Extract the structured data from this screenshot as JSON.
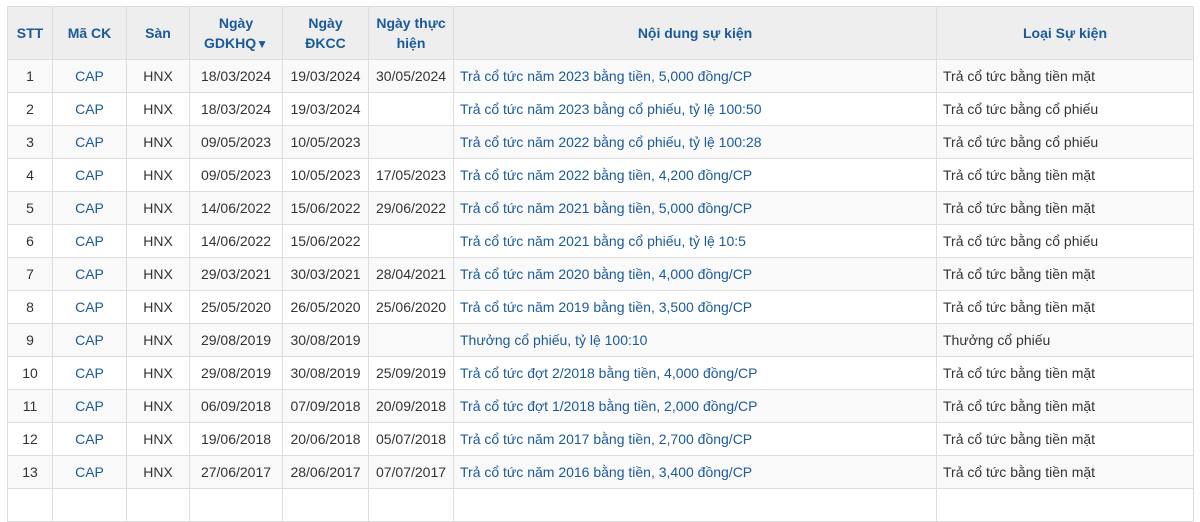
{
  "table": {
    "headers": {
      "stt": "STT",
      "ma_ck": "Mã CK",
      "san": "Sàn",
      "ngay_gdkhq_line1": "Ngày",
      "ngay_gdkhq_line2": "GDKHQ",
      "sort_indicator": "▼",
      "ngay_dkcc_line1": "Ngày",
      "ngay_dkcc_line2": "ĐKCC",
      "ngay_thuc_hien_line1": "Ngày thực",
      "ngay_thuc_hien_line2": "hiện",
      "noi_dung": "Nội dung sự kiện",
      "loai_su_kien": "Loại Sự kiện"
    },
    "rows": [
      {
        "stt": "1",
        "ma_ck": "CAP",
        "san": "HNX",
        "gdkhq": "18/03/2024",
        "dkcc": "19/03/2024",
        "thuc_hien": "30/05/2024",
        "noi_dung": "Trả cổ tức năm 2023 bằng tiền, 5,000 đồng/CP",
        "loai": "Trả cổ tức bằng tiền mặt"
      },
      {
        "stt": "2",
        "ma_ck": "CAP",
        "san": "HNX",
        "gdkhq": "18/03/2024",
        "dkcc": "19/03/2024",
        "thuc_hien": "",
        "noi_dung": "Trả cổ tức năm 2023 bằng cổ phiếu, tỷ lệ 100:50",
        "loai": "Trả cổ tức bằng cổ phiếu"
      },
      {
        "stt": "3",
        "ma_ck": "CAP",
        "san": "HNX",
        "gdkhq": "09/05/2023",
        "dkcc": "10/05/2023",
        "thuc_hien": "",
        "noi_dung": "Trả cổ tức năm 2022 bằng cổ phiếu, tỷ lệ 100:28",
        "loai": "Trả cổ tức bằng cổ phiếu"
      },
      {
        "stt": "4",
        "ma_ck": "CAP",
        "san": "HNX",
        "gdkhq": "09/05/2023",
        "dkcc": "10/05/2023",
        "thuc_hien": "17/05/2023",
        "noi_dung": "Trả cổ tức năm 2022 bằng tiền, 4,200 đồng/CP",
        "loai": "Trả cổ tức bằng tiền mặt"
      },
      {
        "stt": "5",
        "ma_ck": "CAP",
        "san": "HNX",
        "gdkhq": "14/06/2022",
        "dkcc": "15/06/2022",
        "thuc_hien": "29/06/2022",
        "noi_dung": "Trả cổ tức năm 2021 bằng tiền, 5,000 đồng/CP",
        "loai": "Trả cổ tức bằng tiền mặt"
      },
      {
        "stt": "6",
        "ma_ck": "CAP",
        "san": "HNX",
        "gdkhq": "14/06/2022",
        "dkcc": "15/06/2022",
        "thuc_hien": "",
        "noi_dung": "Trả cổ tức năm 2021 bằng cổ phiếu, tỷ lệ 10:5",
        "loai": "Trả cổ tức bằng cổ phiếu"
      },
      {
        "stt": "7",
        "ma_ck": "CAP",
        "san": "HNX",
        "gdkhq": "29/03/2021",
        "dkcc": "30/03/2021",
        "thuc_hien": "28/04/2021",
        "noi_dung": "Trả cổ tức năm 2020 bằng tiền, 4,000 đồng/CP",
        "loai": "Trả cổ tức bằng tiền mặt"
      },
      {
        "stt": "8",
        "ma_ck": "CAP",
        "san": "HNX",
        "gdkhq": "25/05/2020",
        "dkcc": "26/05/2020",
        "thuc_hien": "25/06/2020",
        "noi_dung": "Trả cổ tức năm 2019 bằng tiền, 3,500 đồng/CP",
        "loai": "Trả cổ tức bằng tiền mặt"
      },
      {
        "stt": "9",
        "ma_ck": "CAP",
        "san": "HNX",
        "gdkhq": "29/08/2019",
        "dkcc": "30/08/2019",
        "thuc_hien": "",
        "noi_dung": "Thưởng cổ phiếu, tỷ lệ 100:10",
        "loai": "Thưởng cổ phiếu"
      },
      {
        "stt": "10",
        "ma_ck": "CAP",
        "san": "HNX",
        "gdkhq": "29/08/2019",
        "dkcc": "30/08/2019",
        "thuc_hien": "25/09/2019",
        "noi_dung": "Trả cổ tức đợt 2/2018 bằng tiền, 4,000 đồng/CP",
        "loai": "Trả cổ tức bằng tiền mặt"
      },
      {
        "stt": "11",
        "ma_ck": "CAP",
        "san": "HNX",
        "gdkhq": "06/09/2018",
        "dkcc": "07/09/2018",
        "thuc_hien": "20/09/2018",
        "noi_dung": "Trả cổ tức đợt 1/2018 bằng tiền, 2,000 đồng/CP",
        "loai": "Trả cổ tức bằng tiền mặt"
      },
      {
        "stt": "12",
        "ma_ck": "CAP",
        "san": "HNX",
        "gdkhq": "19/06/2018",
        "dkcc": "20/06/2018",
        "thuc_hien": "05/07/2018",
        "noi_dung": "Trả cổ tức năm 2017 bằng tiền, 2,700 đồng/CP",
        "loai": "Trả cổ tức bằng tiền mặt"
      },
      {
        "stt": "13",
        "ma_ck": "CAP",
        "san": "HNX",
        "gdkhq": "27/06/2017",
        "dkcc": "28/06/2017",
        "thuc_hien": "07/07/2017",
        "noi_dung": "Trả cổ tức năm 2016 bằng tiền, 3,400 đồng/CP",
        "loai": "Trả cổ tức bằng tiền mặt"
      },
      {
        "stt": "",
        "ma_ck": "",
        "san": "",
        "gdkhq": "",
        "dkcc": "",
        "thuc_hien": "",
        "noi_dung": "",
        "loai": ""
      }
    ]
  },
  "colors": {
    "header_text": "#1b5a9a",
    "link": "#1b5a9a",
    "header_bg": "#eeeeee",
    "stripe_bg": "#f9f9f9",
    "border": "#dddddd"
  }
}
